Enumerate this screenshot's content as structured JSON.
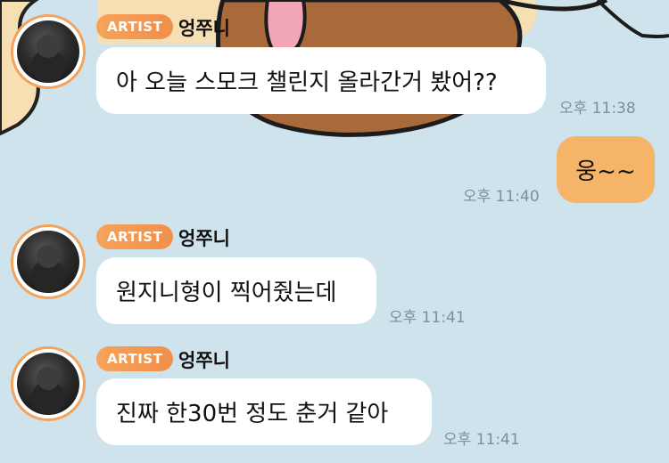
{
  "colors": {
    "background": "#cfe3ec",
    "badge": "#f39a52",
    "avatar_ring": "#f2a35e",
    "other_bubble": "#ffffff",
    "my_bubble": "#f6b469",
    "time_text": "#7d8f9a"
  },
  "messages": [
    {
      "badge": "ARTIST",
      "sender": "엉쭈니",
      "text": "아 오늘 스모크 챌린지 올라간거 봤어??",
      "time": "오후 11:38"
    },
    {
      "text": "웅~~",
      "time": "오후 11:40"
    },
    {
      "badge": "ARTIST",
      "sender": "엉쭈니",
      "text": "원지니형이 찍어줬는데",
      "time": "오후 11:41"
    },
    {
      "badge": "ARTIST",
      "sender": "엉쭈니",
      "text": "진짜 한30번 정도 춘거 같아",
      "time": "오후 11:41"
    }
  ]
}
